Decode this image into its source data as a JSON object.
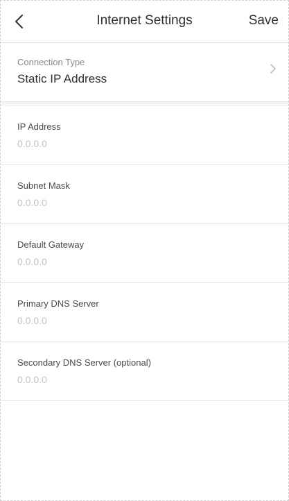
{
  "header": {
    "title": "Internet Settings",
    "save_label": "Save",
    "back_icon": "chevron-left-icon"
  },
  "connection": {
    "label": "Connection Type",
    "value": "Static IP Address",
    "chevron_icon": "chevron-right-icon"
  },
  "fields": [
    {
      "label": "IP Address",
      "placeholder": "0.0.0.0",
      "value": ""
    },
    {
      "label": "Subnet Mask",
      "placeholder": "0.0.0.0",
      "value": ""
    },
    {
      "label": "Default Gateway",
      "placeholder": "0.0.0.0",
      "value": ""
    },
    {
      "label": "Primary DNS Server",
      "placeholder": "0.0.0.0",
      "value": ""
    },
    {
      "label": "Secondary DNS Server (optional)",
      "placeholder": "0.0.0.0",
      "value": ""
    }
  ],
  "colors": {
    "text": "#2f2f2f",
    "label": "#8a8a8a",
    "placeholder": "#c2c2c2",
    "divider": "#e6e6e6",
    "section_gap": "#f2f6f8"
  }
}
